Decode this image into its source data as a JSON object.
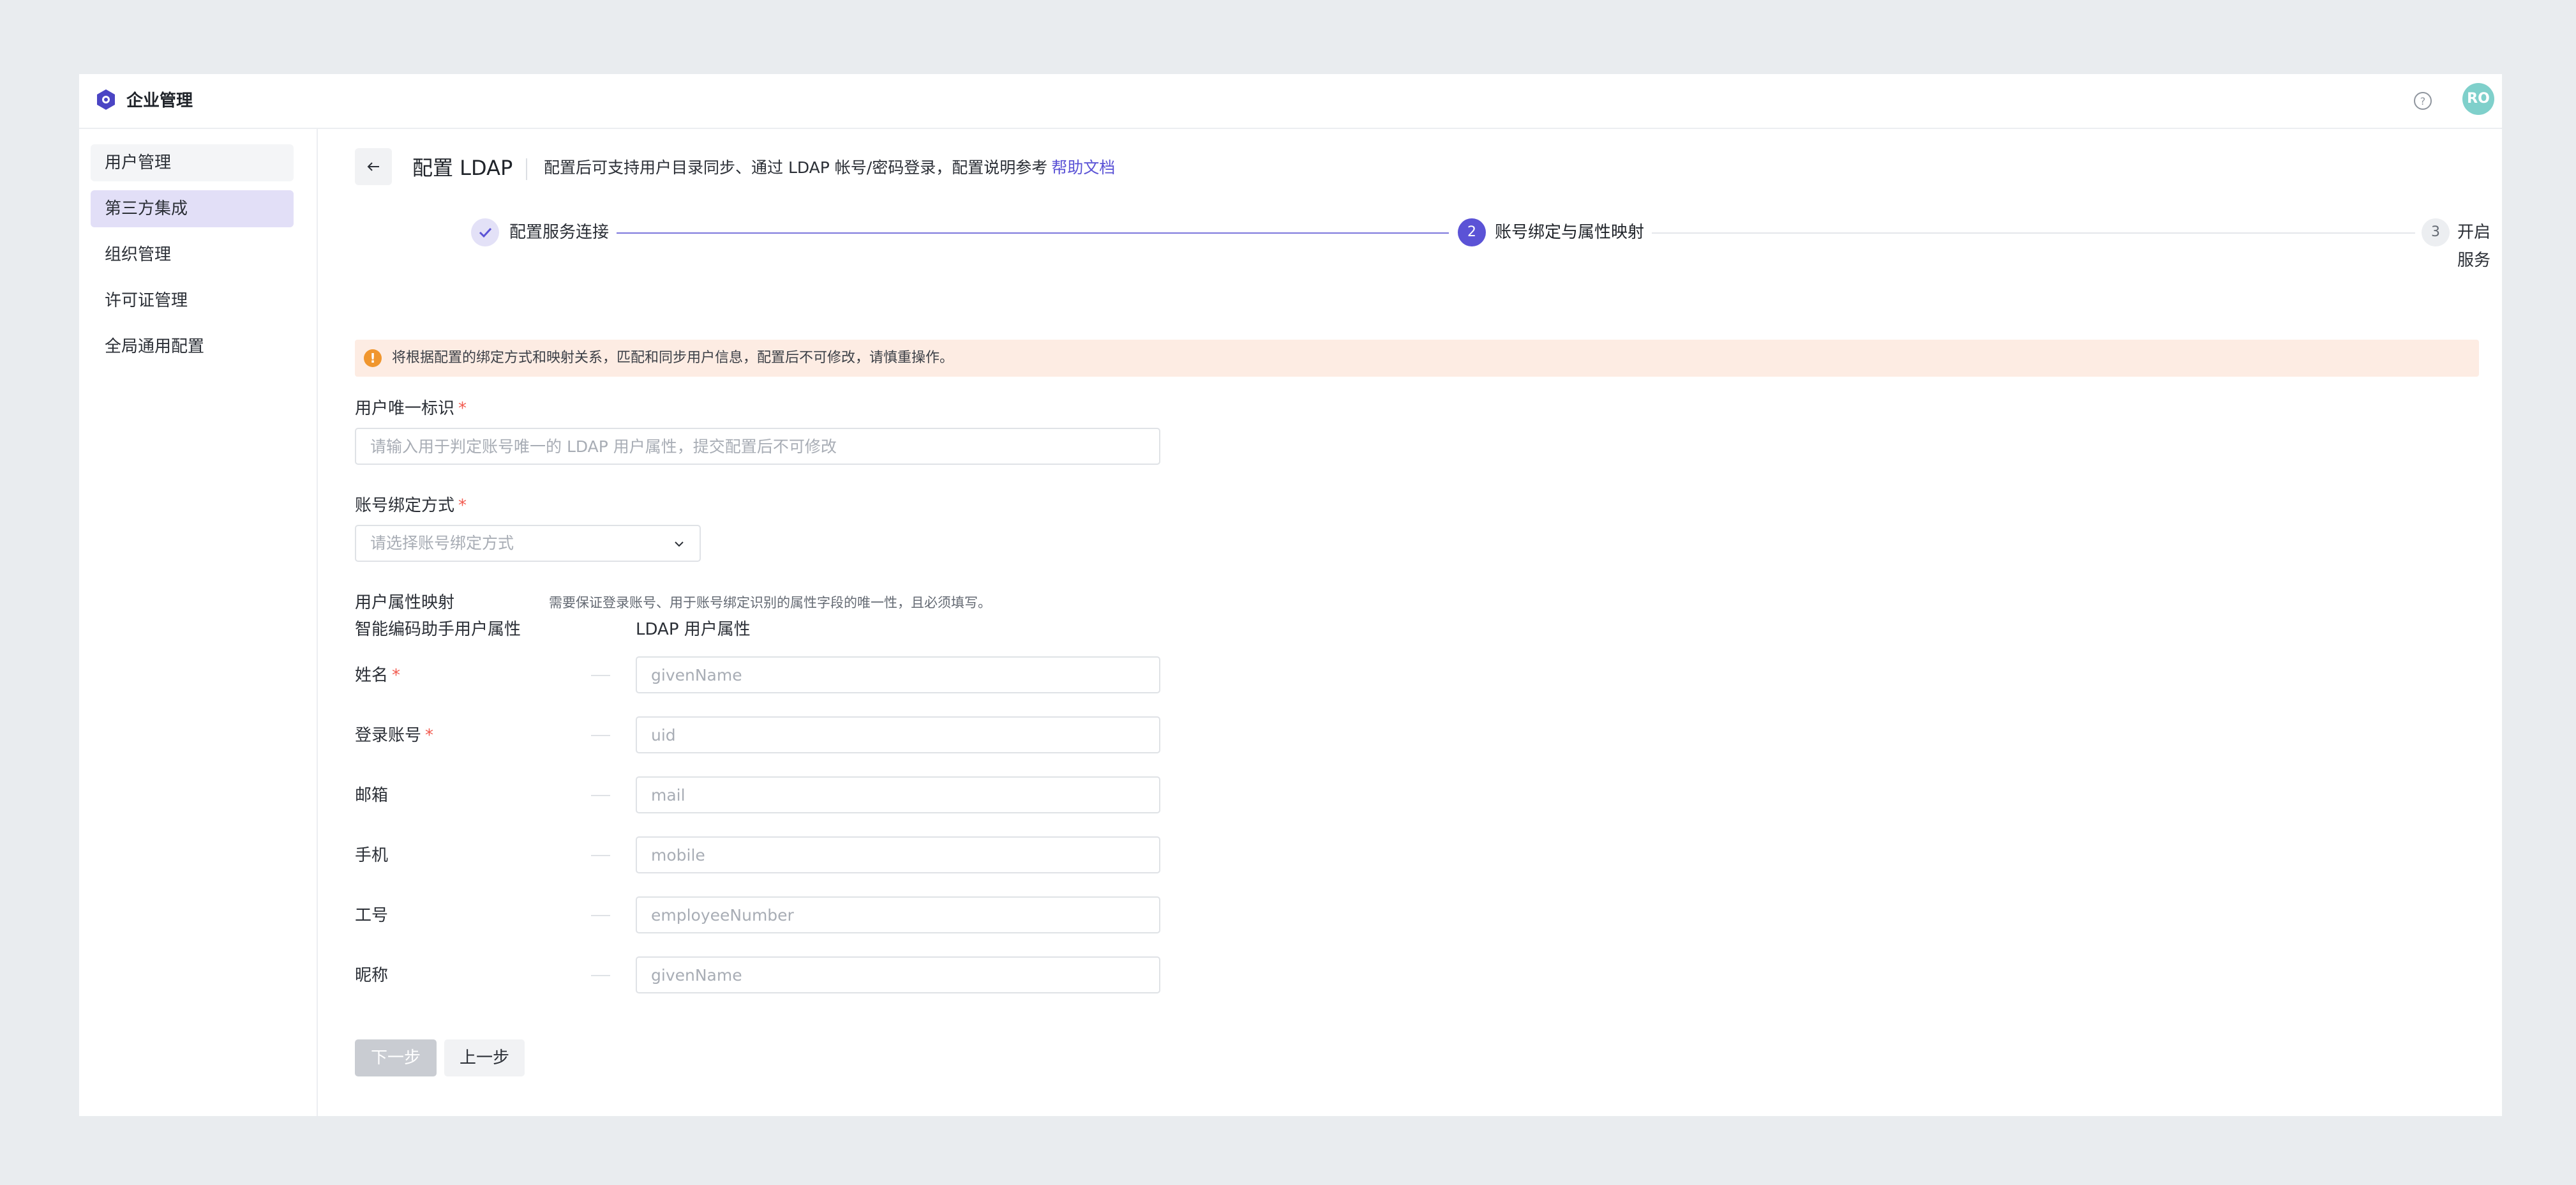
{
  "app": {
    "title": "企业管理",
    "avatar_initials": "RO",
    "accent": "#5b53d6"
  },
  "sidebar": {
    "items": [
      {
        "label": "用户管理"
      },
      {
        "label": "第三方集成"
      },
      {
        "label": "组织管理"
      },
      {
        "label": "许可证管理"
      },
      {
        "label": "全局通用配置"
      }
    ],
    "active": "第三方集成"
  },
  "header": {
    "title": "配置 LDAP",
    "description": "配置后可支持用户目录同步、通过 LDAP 帐号/密码登录，配置说明参考",
    "doc_link": "帮助文档"
  },
  "steps": [
    {
      "index": "1",
      "label": "配置服务连接",
      "status": "done"
    },
    {
      "index": "2",
      "label": "账号绑定与属性映射",
      "status": "current"
    },
    {
      "index": "3",
      "label": "开启服务",
      "status": "pending"
    }
  ],
  "alert": {
    "text": "将根据配置的绑定方式和映射关系，匹配和同步用户信息，配置后不可修改，请慎重操作。",
    "color": "#f0962e"
  },
  "form": {
    "unique_id": {
      "label": "用户唯一标识",
      "required_mark": "*",
      "placeholder": "请输入用于判定账号唯一的 LDAP 用户属性，提交配置后不可修改"
    },
    "binding": {
      "label": "账号绑定方式",
      "required_mark": "*",
      "placeholder": "请选择账号绑定方式"
    },
    "mapping": {
      "label": "用户属性映射",
      "hint": "需要保证登录账号、用于账号绑定识别的属性字段的唯一性，且必须填写。",
      "col_left": "智能编码助手用户属性",
      "col_right": "LDAP 用户属性",
      "rows": [
        {
          "label": "姓名",
          "required_mark": "*",
          "placeholder": "givenName"
        },
        {
          "label": "登录账号",
          "required_mark": "*",
          "placeholder": "uid"
        },
        {
          "label": "邮箱",
          "required_mark": "",
          "placeholder": "mail"
        },
        {
          "label": "手机",
          "required_mark": "",
          "placeholder": "mobile"
        },
        {
          "label": "工号",
          "required_mark": "",
          "placeholder": "employeeNumber"
        },
        {
          "label": "昵称",
          "required_mark": "",
          "placeholder": "givenName"
        }
      ]
    }
  },
  "actions": {
    "next": "下一步",
    "prev": "上一步"
  }
}
